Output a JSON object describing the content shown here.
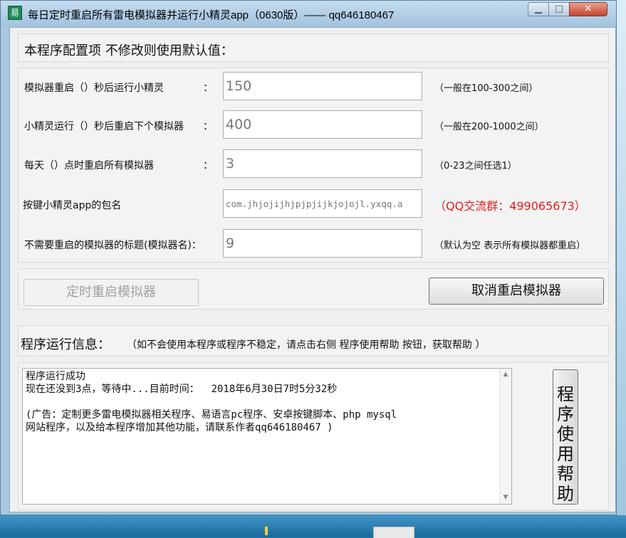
{
  "window": {
    "title": "每日定时重启所有雷电模拟器并运行小精灵app（0630版）—— qq646180467",
    "min_glyph": "▁",
    "max_glyph": "□",
    "close_glyph": "✕"
  },
  "config": {
    "header": "本程序配置项 不修改则使用默认值：",
    "rows": [
      {
        "label": "模拟器重启（）秒后运行小精灵",
        "colon": "：",
        "value": "150",
        "hint": "（一般在100-300之间）"
      },
      {
        "label": "小精灵运行（）秒后重启下个模拟器",
        "colon": "：",
        "value": "400",
        "hint": "（一般在200-1000之间）"
      },
      {
        "label": "每天（）点时重启所有模拟器",
        "colon": "：",
        "value": "3",
        "hint": "（0-23之间任选1）"
      },
      {
        "label": "按键小精灵app的包名",
        "colon": "",
        "value": "com.jhjojijhjpjpjijkjojojl.yxqq.a",
        "hint": "（QQ交流群：499065673）"
      },
      {
        "label": "不需要重启的模拟器的标题(模拟器名)：",
        "colon": "",
        "value": "9",
        "hint": "（默认为空 表示所有模拟器都重启）"
      }
    ]
  },
  "buttons": {
    "schedule_restart": "定时重启模拟器",
    "cancel_restart": "取消重启模拟器",
    "help": "程序使用帮助"
  },
  "info": {
    "header": "程序运行信息：",
    "header_note": "（如不会使用本程序或程序不稳定，请点击右侧 程序使用帮助 按钮，获取帮助 ）",
    "log": "程序运行成功\n现在还没到3点，等待中...目前时间：  2018年6月30日7时5分32秒\n\n(广告：定制更多雷电模拟器相关程序、易语言pc程序、安卓按键脚本、php mysql\n网站程序，以及给本程序增加其他功能，请联系作者qq646180467 )"
  }
}
